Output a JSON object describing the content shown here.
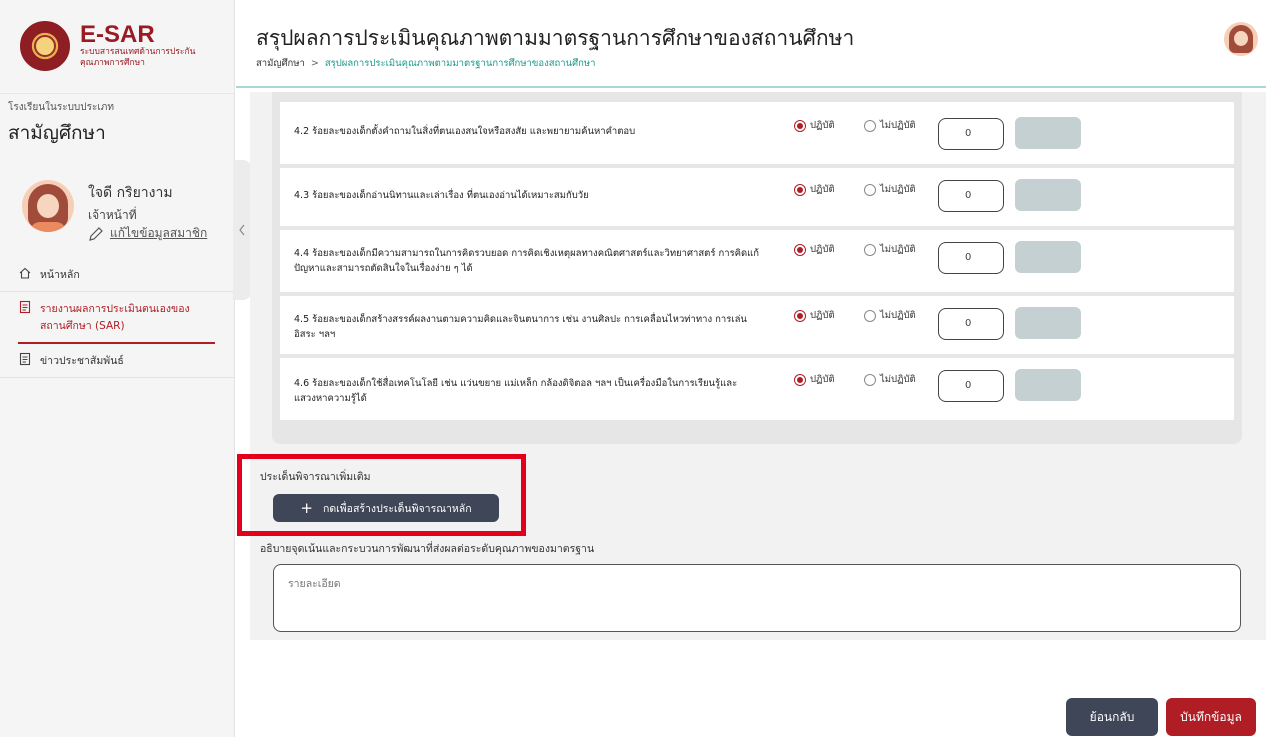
{
  "sidebar": {
    "logo_title": "E-SAR",
    "logo_subtitle_line1": "ระบบสารสนเทศด้านการประกัน",
    "logo_subtitle_line2": "คุณภาพการศึกษา",
    "school_type_label": "โรงเรียนในระบบประเภท",
    "school_type": "สามัญศึกษา",
    "user_name": "ใจดี กริยางาม",
    "user_role": "เจ้าหน้าที่",
    "edit_profile": "แก้ไขข้อมูลสมาชิก",
    "nav": [
      {
        "label": "หน้าหลัก",
        "icon": "home-icon"
      },
      {
        "label": "รายงานผลการประเมินตนเองของสถานศึกษา (SAR)",
        "icon": "document-icon",
        "active": true
      },
      {
        "label": "ข่าวประชาสัมพันธ์",
        "icon": "news-icon"
      }
    ]
  },
  "header": {
    "title": "สรุปผลการประเมินคุณภาพตามมาตรฐานการศึกษาของสถานศึกษา",
    "breadcrumb_root": "สามัญศึกษา",
    "breadcrumb_sep": ">",
    "breadcrumb_current": "สรุปผลการประเมินคุณภาพตามมาตรฐานการศึกษาของสถานศึกษา"
  },
  "criteria": [
    {
      "text": "4.2 ร้อยละของเด็กตั้งคำถามในสิ่งที่ตนเองสนใจหรือสงสัย และพยายามค้นหาคำตอบ",
      "option_yes": "ปฏิบัติ",
      "option_no": "ไม่ปฏิบัติ",
      "selected": "yes",
      "value": "0"
    },
    {
      "text": "4.3 ร้อยละของเด็กอ่านนิทานและเล่าเรื่อง ที่ตนเองอ่านได้เหมาะสมกับวัย",
      "option_yes": "ปฏิบัติ",
      "option_no": "ไม่ปฏิบัติ",
      "selected": "yes",
      "value": "0"
    },
    {
      "text": "4.4 ร้อยละของเด็กมีความสามารถในการคิดรวบยอด การคิดเชิงเหตุผลทางคณิตศาสตร์และวิทยาศาสตร์ การคิดแก้ปัญหาและสามารถตัดสินใจในเรื่องง่าย ๆ ได้",
      "option_yes": "ปฏิบัติ",
      "option_no": "ไม่ปฏิบัติ",
      "selected": "yes",
      "value": "0"
    },
    {
      "text": "4.5 ร้อยละของเด็กสร้างสรรค์ผลงานตามความคิดและจินตนาการ เช่น งานศิลปะ การเคลื่อนไหวท่าทาง การเล่นอิสระ ฯลฯ",
      "option_yes": "ปฏิบัติ",
      "option_no": "ไม่ปฏิบัติ",
      "selected": "yes",
      "value": "0"
    },
    {
      "text": "4.6 ร้อยละของเด็กใช้สื่อเทคโนโลยี เช่น แว่นขยาย แม่เหล็ก กล้องดิจิตอล ฯลฯ เป็นเครื่องมือในการเรียนรู้และแสวงหาความรู้ได้",
      "option_yes": "ปฏิบัติ",
      "option_no": "ไม่ปฏิบัติ",
      "selected": "yes",
      "value": "0"
    }
  ],
  "extra": {
    "label": "ประเด็นพิจารณาเพิ่มเติม",
    "create_button": "กดเพื่อสร้างประเด็นพิจารณาหลัก",
    "plus": "+"
  },
  "description": {
    "label": "อธิบายจุดเน้นและกระบวนการพัฒนาที่ส่งผลต่อระดับคุณภาพของมาตรฐาน",
    "placeholder": "รายละเอียด"
  },
  "actions": {
    "back": "ย้อนกลับ",
    "save": "บันทึกข้อมูล"
  },
  "colors": {
    "brand": "#b01d25",
    "dark_button": "#3e4658",
    "teal": "#1a9a8a",
    "highlight": "#e3001b"
  }
}
